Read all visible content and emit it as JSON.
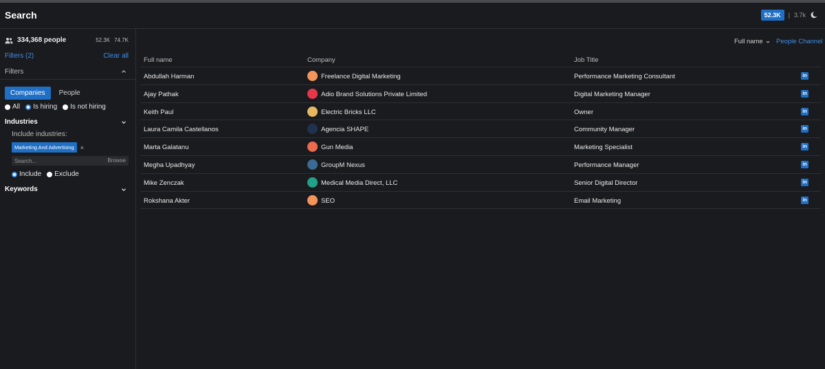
{
  "header": {
    "title": "Search",
    "credits_primary": "52.3K",
    "credits_separator": "|",
    "credits_secondary": "3.7k"
  },
  "sidebar": {
    "people_count": "334,368 people",
    "stat_a": "52.3K",
    "stat_b": "74.7K",
    "filters_count": "Filters (2)",
    "clear_all": "Clear all",
    "filters_label": "Filters",
    "segments": [
      "Companies",
      "People"
    ],
    "hiring_options": [
      "All",
      "Is hiring",
      "Is not hiring"
    ],
    "hiring_selected": "Is hiring",
    "industries_label": "Industries",
    "include_industries": "Include industries:",
    "industry_tag": "Marketing And Advertising",
    "tag_remove": "×",
    "industry_search_placeholder": "Search...",
    "browse": "Browse",
    "include_exclude": [
      "Include",
      "Exclude"
    ],
    "include_selected": "Include",
    "keywords_label": "Keywords"
  },
  "main": {
    "sort_label": "Full name",
    "people_channel": "People Channel",
    "columns": [
      "Full name",
      "Company",
      "Job Title"
    ],
    "rows": [
      {
        "name": "Abdullah Harman",
        "company": "Freelance Digital Marketing",
        "title": "Performance Marketing Consultant",
        "logo_color": "#f3955a"
      },
      {
        "name": "Ajay Pathak",
        "company": "Adio Brand Solutions Private Limited",
        "title": "Digital Marketing Manager",
        "logo_color": "#e8374a"
      },
      {
        "name": "Keith Paul",
        "company": "Electric Bricks LLC",
        "title": "Owner",
        "logo_color": "#e7b860"
      },
      {
        "name": "Laura Camila Castellanos",
        "company": "Agencia SHAPE",
        "title": "Community Manager",
        "logo_color": "#1f3350"
      },
      {
        "name": "Marta Galatanu",
        "company": "Gun Media",
        "title": "Marketing Specialist",
        "logo_color": "#ec6a4f"
      },
      {
        "name": "Megha Upadhyay",
        "company": "GroupM Nexus",
        "title": "Performance Manager",
        "logo_color": "#3b6b94"
      },
      {
        "name": "Mike Zenczak",
        "company": "Medical Media Direct, LLC",
        "title": "Senior Digital Director",
        "logo_color": "#23a08a"
      },
      {
        "name": "Rokshana Akter",
        "company": "SEO",
        "title": "Email Marketing",
        "logo_color": "#f3955a"
      }
    ],
    "linkedin_glyph": "in"
  },
  "colors": {
    "background": "#1a1b1e",
    "accent": "#1f6fc5",
    "link": "#3d8fe8",
    "divider": "#2e2f33"
  }
}
